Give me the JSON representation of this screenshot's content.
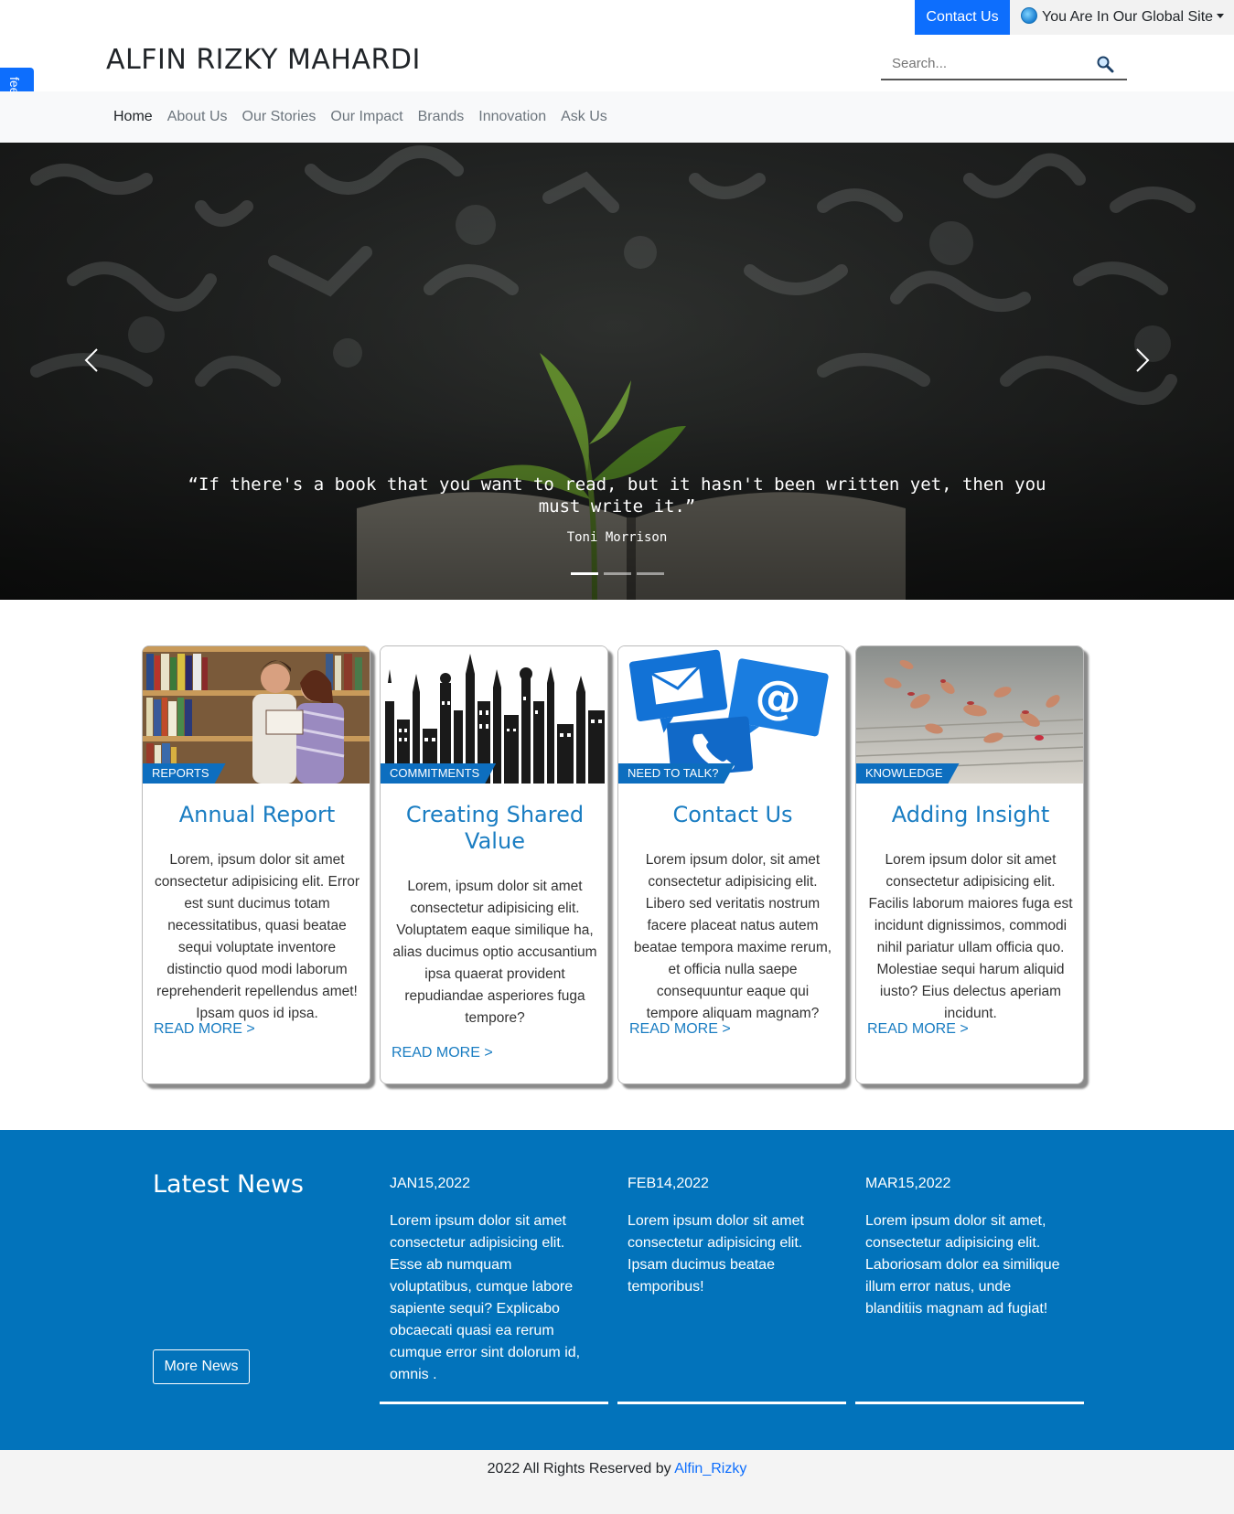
{
  "topbar": {
    "contact_label": "Contact Us",
    "global_site_label": "You Are In Our Global Site"
  },
  "brand": {
    "name": "ALFIN RIZKY MAHARDI"
  },
  "search": {
    "placeholder": "Search..."
  },
  "feedback": {
    "label": "feedback"
  },
  "nav": {
    "items": [
      {
        "label": "Home"
      },
      {
        "label": "About Us"
      },
      {
        "label": "Our Stories"
      },
      {
        "label": "Our Impact"
      },
      {
        "label": "Brands"
      },
      {
        "label": "Innovation"
      },
      {
        "label": "Ask Us"
      }
    ],
    "active_index": 0
  },
  "hero": {
    "quote": "“If there's a book that you want to read, but it hasn't been written yet, then you must write it.”",
    "author": "Toni Morrison",
    "slide_count": 3,
    "active_slide": 1
  },
  "cards": [
    {
      "tag": "REPORTS",
      "title": "Annual Report",
      "body": "Lorem, ipsum dolor sit amet consectetur adipisicing elit. Error est sunt ducimus totam necessitatibus, quasi beatae sequi voluptate inventore distinctio quod modi laborum reprehenderit repellendus amet! Ipsam quos id ipsa.",
      "link": "READ MORE >"
    },
    {
      "tag": "COMMITMENTS",
      "title": "Creating Shared Value",
      "body": "Lorem, ipsum dolor sit amet consectetur adipisicing elit. Voluptatem eaque similique ha, alias ducimus optio accusantium ipsa quaerat provident repudiandae asperiores fuga tempore?",
      "link": "READ MORE >"
    },
    {
      "tag": "NEED TO TALK?",
      "title": "Contact Us",
      "body": "Lorem ipsum dolor, sit amet consectetur adipisicing elit. Libero sed veritatis nostrum facere placeat natus autem beatae tempora maxime rerum, et officia nulla saepe consequuntur eaque qui tempore aliquam magnam?",
      "link": "READ MORE >"
    },
    {
      "tag": "KNOWLEDGE",
      "title": "Adding Insight",
      "body": "Lorem ipsum dolor sit amet consectetur adipisicing elit. Facilis laborum maiores fuga est incidunt dignissimos, commodi nihil pariatur ullam officia quo. Molestiae sequi harum aliquid iusto? Eius delectus aperiam incidunt.",
      "link": "READ MORE >"
    }
  ],
  "news": {
    "heading": "Latest News",
    "more_label": "More News",
    "items": [
      {
        "date": "JAN15,2022",
        "text": "Lorem ipsum dolor sit amet consectetur adipisicing elit. Esse ab numquam voluptatibus, cumque labore sapiente sequi? Explicabo obcaecati quasi ea rerum cumque error sint dolorum id, omnis ."
      },
      {
        "date": "FEB14,2022",
        "text": "Lorem ipsum dolor sit amet consectetur adipisicing elit. Ipsam ducimus beatae temporibus!"
      },
      {
        "date": "MAR15,2022",
        "text": "Lorem ipsum dolor sit amet, consectetur adipisicing elit. Laboriosam dolor ea similique illum error natus, unde blanditiis magnam ad fugiat!"
      }
    ]
  },
  "footer": {
    "text": "2022 All Rights Reserved by ",
    "link": "Alfin_Rizky"
  },
  "colors": {
    "primary": "#0d6efd",
    "card_title": "#1a7dc2",
    "news_bg": "#0273bb",
    "tag_bg": "#0d6ebf"
  }
}
